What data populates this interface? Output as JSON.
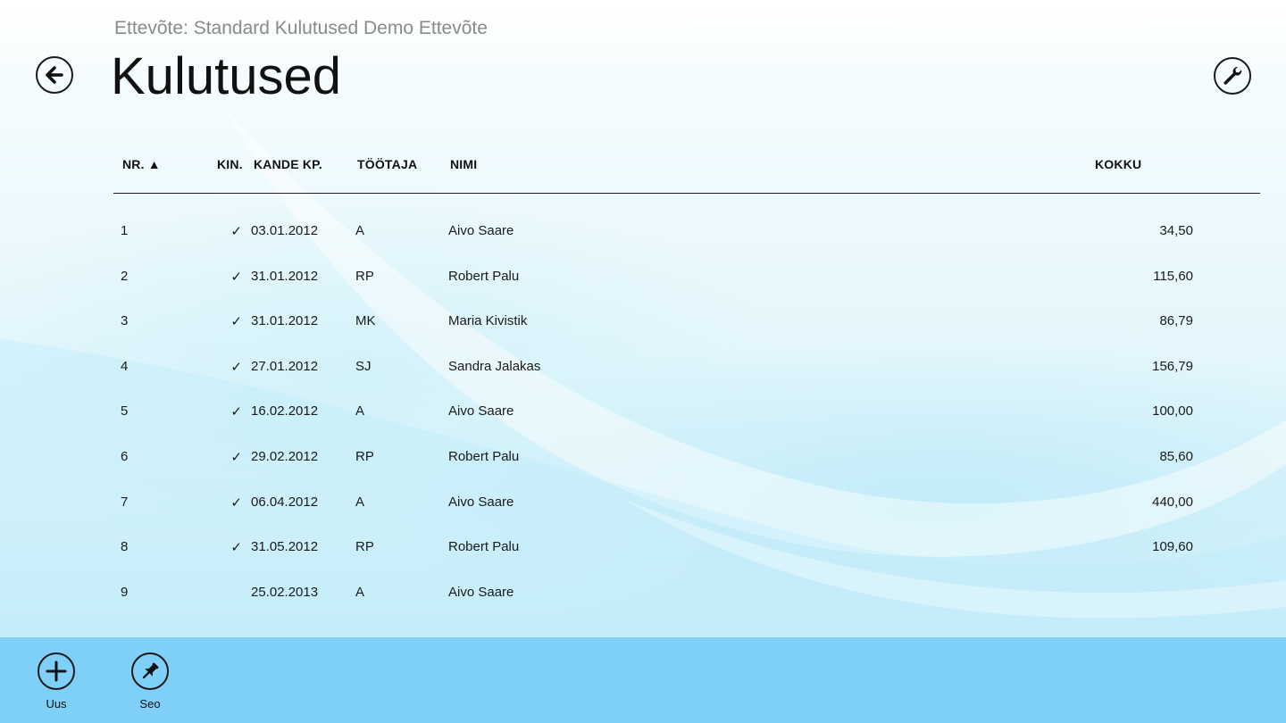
{
  "header": {
    "breadcrumb": "Ettevõte: Standard Kulutused Demo Ettevõte",
    "title": "Kulutused"
  },
  "table": {
    "columns": {
      "nr": "NR. ▲",
      "kin": "KIN.",
      "date": "KANDE KP.",
      "employee": "TÖÖTAJA",
      "name": "NIMI",
      "total": "KOKKU"
    },
    "rows": [
      {
        "nr": "1",
        "kin": "✓",
        "date": "03.01.2012",
        "employee": "A",
        "name": "Aivo Saare",
        "total": "34,50"
      },
      {
        "nr": "2",
        "kin": "✓",
        "date": "31.01.2012",
        "employee": "RP",
        "name": "Robert Palu",
        "total": "115,60"
      },
      {
        "nr": "3",
        "kin": "✓",
        "date": "31.01.2012",
        "employee": "MK",
        "name": "Maria Kivistik",
        "total": "86,79"
      },
      {
        "nr": "4",
        "kin": "✓",
        "date": "27.01.2012",
        "employee": "SJ",
        "name": "Sandra Jalakas",
        "total": "156,79"
      },
      {
        "nr": "5",
        "kin": "✓",
        "date": "16.02.2012",
        "employee": "A",
        "name": "Aivo Saare",
        "total": "100,00"
      },
      {
        "nr": "6",
        "kin": "✓",
        "date": "29.02.2012",
        "employee": "RP",
        "name": "Robert Palu",
        "total": "85,60"
      },
      {
        "nr": "7",
        "kin": "✓",
        "date": "06.04.2012",
        "employee": "A",
        "name": "Aivo Saare",
        "total": "440,00"
      },
      {
        "nr": "8",
        "kin": "✓",
        "date": "31.05.2012",
        "employee": "RP",
        "name": "Robert Palu",
        "total": "109,60"
      },
      {
        "nr": "9",
        "kin": "",
        "date": "25.02.2013",
        "employee": "A",
        "name": "Aivo Saare",
        "total": ""
      }
    ]
  },
  "appbar": {
    "new_label": "Uus",
    "pin_label": "Seo"
  },
  "icons": {
    "back": "back-arrow-icon",
    "settings": "wrench-icon",
    "new": "plus-icon",
    "pin": "pin-icon"
  },
  "colors": {
    "appbar": "#7fd0f9",
    "text": "#111111",
    "breadcrumb": "#8a8a8a"
  }
}
